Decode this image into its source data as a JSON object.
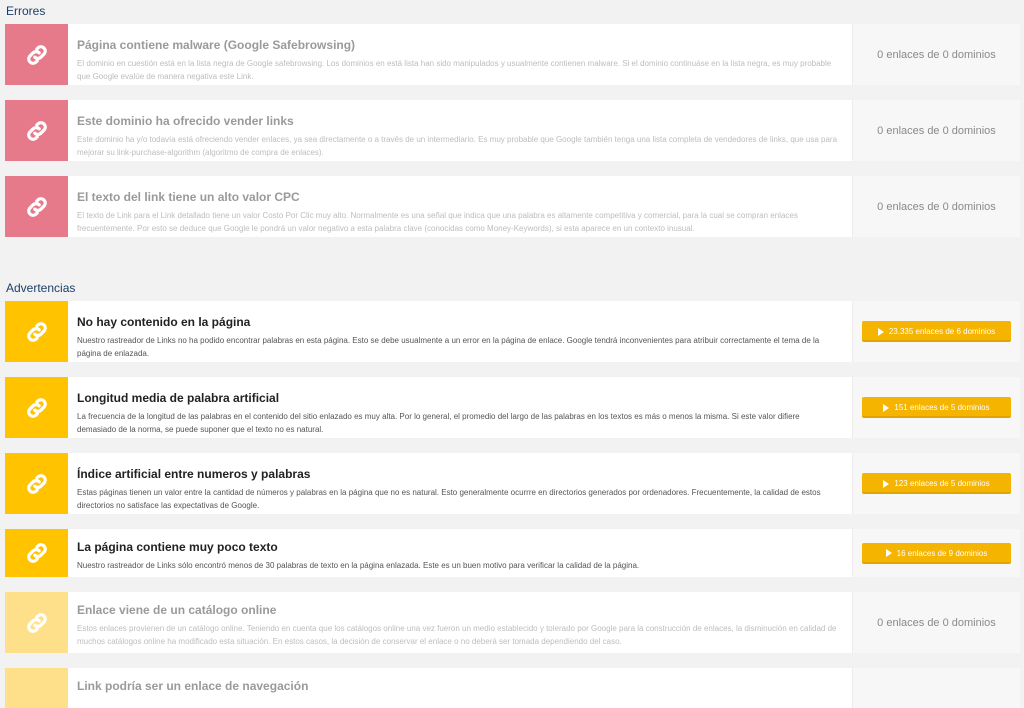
{
  "sections": {
    "errors_title": "Errores",
    "warnings_title": "Advertencias"
  },
  "colors": {
    "error_accent": "#e67a8b",
    "warning_accent": "#ffc300",
    "button": "#f5b400"
  },
  "icons": {
    "card_icon": "link-icon",
    "button_icon": "play-icon"
  },
  "errors": [
    {
      "title": "Página contiene malware (Google Safebrowsing)",
      "desc": "El dominio en cuestión está en la lista negra de Google safebrowsing. Los dominios en está lista han sido manipulados y usualmente contienen malware. Si el dominio continuáse en la lista negra, es muy probable que Google evalúe de manera negativa este Link.",
      "count": "0 enlaces de 0 dominios"
    },
    {
      "title": "Este dominio ha ofrecido vender links",
      "desc": "Este dominio ha y/o todavía está ofreciendo vender enlaces, ya sea directamente o a través de un intermediario. Es muy probable que Google también tenga una lista completa de vendedores de links, que usa para mejorar su link-purchase-algorithm (algoritmo de compra de enlaces).",
      "count": "0 enlaces de 0 dominios"
    },
    {
      "title": "El texto del link tiene un alto valor CPC",
      "desc": "El texto de Link para el Link detallado tiene un valor Costo Por Clic muy alto. Normalmente es una señal que indica que una palabra es altamente competitiva y comercial, para la cual se compran enlaces frecuentemente. Por esto se deduce que Google le pondrá un valor negativo a esta palabra clave (conocidas como Money-Keywords), si esta aparece en un contexto inusual.",
      "count": "0 enlaces de 0 dominios"
    }
  ],
  "warnings": [
    {
      "title": "No hay contenido en la página",
      "desc": "Nuestro rastreador de Links no ha podido encontrar palabras en esta página. Esto se debe usualmente a un error en la página de enlace. Google tendrá inconvenientes para atribuir correctamente el tema de la página de enlazada.",
      "count": "23.335 enlaces de 6 dominios"
    },
    {
      "title": "Longitud media de palabra artificial",
      "desc": "La frecuencia de la longitud de las palabras en el contenido del sitio enlazado es muy alta. Por lo general, el promedio del largo de las palabras en los textos es más o menos la misma. Si este valor difiere demasiado de la norma, se puede suponer que el texto no es natural.",
      "count": "151 enlaces de 5 dominios"
    },
    {
      "title": "Índice artificial entre numeros y palabras",
      "desc": "Estas páginas tienen un valor entre la cantidad de números y palabras en la página que no es natural. Esto generalmente ocurrre en directorios generados por ordenadores. Frecuentemente, la calidad de estos directorios no satisface las expectativas de Google.",
      "count": "123 enlaces de 5 dominios"
    },
    {
      "title": "La página contiene muy poco texto",
      "desc": "Nuestro rastreador de Links sólo encontró menos de 30 palabras de texto en la página enlazada. Este es un buen motivo para verificar la calidad de la página.",
      "count": "16 enlaces de 9 dominios"
    },
    {
      "title": "Enlace viene de un catálogo online",
      "desc": "Estos enlaces provienen de un catálogo online. Teniendo en cuenta que los catálogos online una vez fueron un medio establecido y tolerado por Google para la construcción de enlaces, la disminución en calidad de muchos catálogos online ha modificado esta situación. En estos casos, la decisión de conservar el enlace o no deberá ser tomada dependiendo del caso.",
      "count": "0 enlaces de 0 dominios"
    },
    {
      "title": "Link podría ser un enlace de navegación",
      "desc": "",
      "count": ""
    }
  ]
}
